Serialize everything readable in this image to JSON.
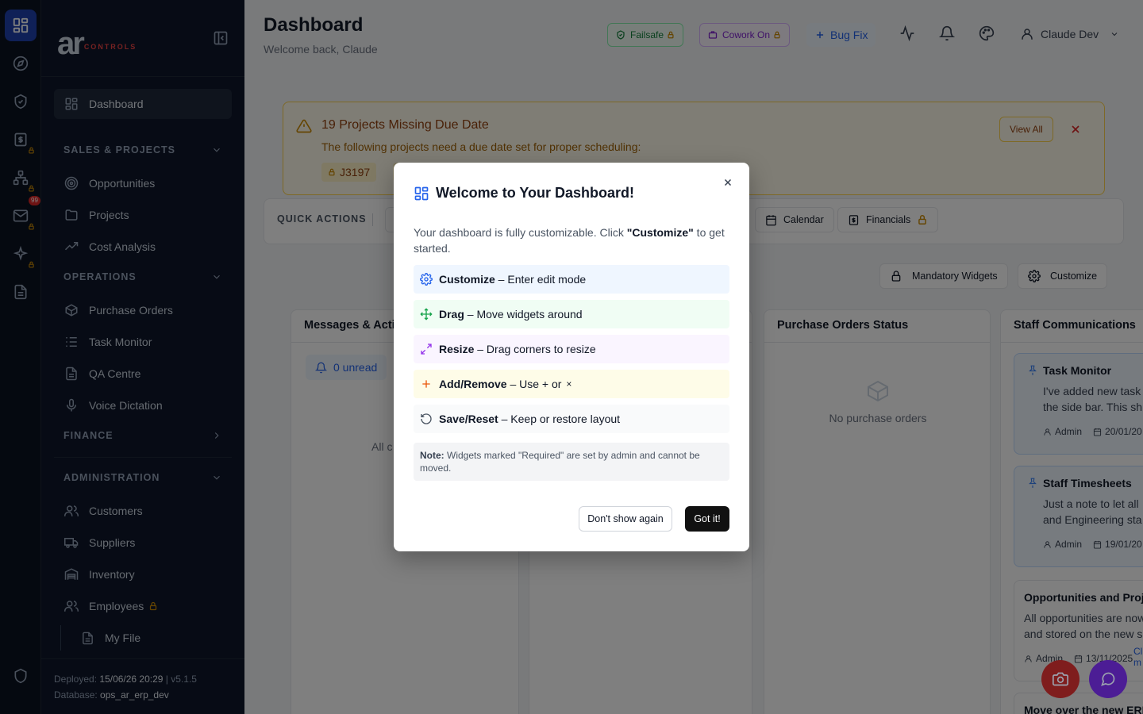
{
  "brand": {
    "logo_big": "ar",
    "logo_small": "CONTROLS"
  },
  "rail": {
    "mail_count": "99"
  },
  "sidebar": {
    "nav": {
      "dashboard": "Dashboard",
      "sales_section": "SALES & PROJECTS",
      "opportunities": "Opportunities",
      "projects": "Projects",
      "cost_analysis": "Cost Analysis",
      "operations_section": "OPERATIONS",
      "purchase_orders": "Purchase Orders",
      "task_monitor": "Task Monitor",
      "qa_centre": "QA Centre",
      "voice_dictation": "Voice Dictation",
      "finance_section": "FINANCE",
      "administration_section": "ADMINISTRATION",
      "customers": "Customers",
      "suppliers": "Suppliers",
      "inventory": "Inventory",
      "employees": "Employees",
      "my_file": "My File"
    },
    "footer": {
      "deployed_label": "Deployed:",
      "deployed_value": "15/06/26 20:29",
      "version": "v5.1.5",
      "database_label": "Database:",
      "database_value": "ops_ar_erp_dev"
    }
  },
  "header": {
    "title": "Dashboard",
    "subtitle": "Welcome back, Claude",
    "failsafe": "Failsafe",
    "cowork": "Cowork On",
    "bugfix": "Bug Fix",
    "user": "Claude Dev"
  },
  "alert": {
    "title": "19 Projects Missing Due Date",
    "text": "The following projects need a due date set for proper scheduling:",
    "chip": "J3197",
    "view_all": "View All"
  },
  "quick_actions": {
    "label": "QUICK ACTIONS",
    "calendar": "Calendar",
    "financials": "Financials"
  },
  "toolbar": {
    "mandatory": "Mandatory Widgets",
    "customize": "Customize"
  },
  "widgets": {
    "messages": {
      "title": "Messages & Acti",
      "unread": "0 unread",
      "empty_partial": "All c"
    },
    "purchase_orders": {
      "title": "Purchase Orders Status",
      "empty": "No purchase orders"
    },
    "staff": {
      "title": "Staff Communications",
      "items": [
        {
          "title": "Task Monitor",
          "line1": "I've added new task",
          "line2": "the side bar. This sh",
          "author": "Admin",
          "date": "20/01/20"
        },
        {
          "title": "Staff Timesheets",
          "line1": "Just a note to let all",
          "line2": "and Engineering sta",
          "author": "Admin",
          "date": "19/01/20"
        },
        {
          "title": "Opportunities and Proj",
          "line1": "All opportunities are now",
          "line2": "and stored on the new s",
          "author": "Admin",
          "date": "13/11/2025",
          "more1": "Cl",
          "more2": "m"
        },
        {
          "title": "Move over the new ERI"
        }
      ]
    }
  },
  "modal": {
    "title": "Welcome to Your Dashboard!",
    "desc_a": "Your dashboard is fully customizable. Click ",
    "desc_b": "\"Customize\"",
    "desc_c": " to get started.",
    "steps": [
      {
        "bold": "Customize",
        "text": " – Enter edit mode",
        "bg": "#eff6ff",
        "color": "#2563eb"
      },
      {
        "bold": "Drag",
        "text": " – Move widgets around",
        "bg": "#f0fdf4",
        "color": "#16a34a"
      },
      {
        "bold": "Resize",
        "text": " – Drag corners to resize",
        "bg": "#faf5ff",
        "color": "#9333ea"
      },
      {
        "bold": "Add/Remove",
        "text": " – Use + or ",
        "suffix": "×",
        "bg": "#fefce8",
        "color": "#ea580c"
      },
      {
        "bold": "Save/Reset",
        "text": " – Keep or restore layout",
        "bg": "#f9fafb",
        "color": "#4b5563"
      }
    ],
    "note_label": "Note:",
    "note_text": " Widgets marked \"Required\" are set by admin and cannot be moved.",
    "dont_show": "Don't show again",
    "got_it": "Got it!"
  },
  "colors": {
    "accent": "#1e40af",
    "warning": "#ca8a04",
    "fab_camera": "#dc2626",
    "fab_chat": "#7c3aed"
  }
}
